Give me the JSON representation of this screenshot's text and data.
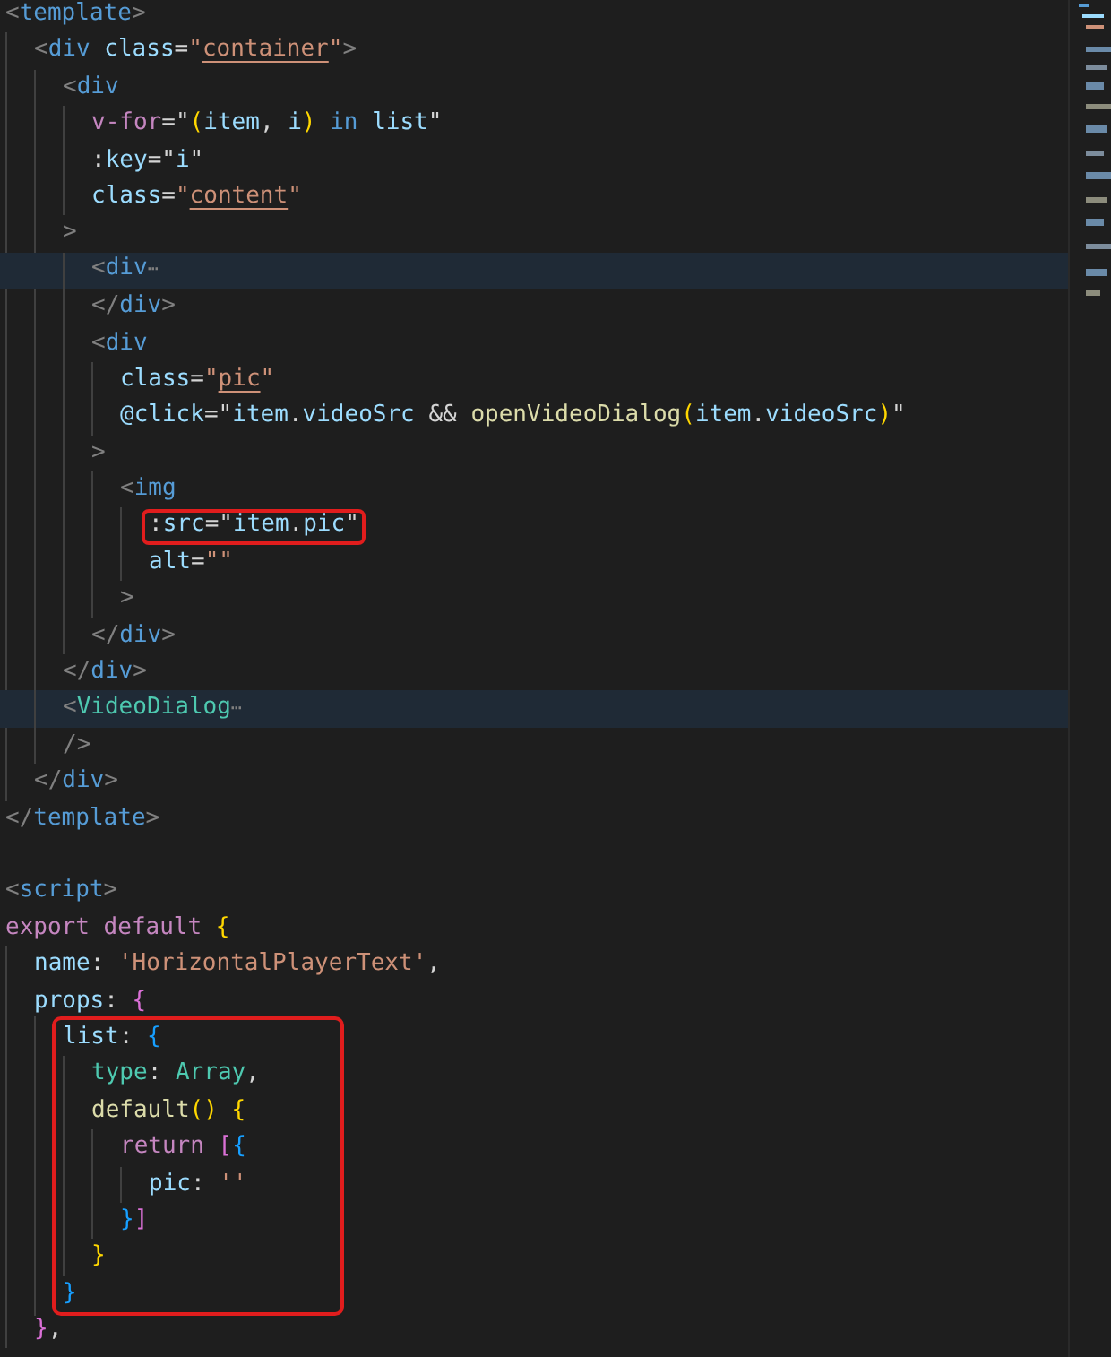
{
  "editor": {
    "lines": [
      {
        "tokens": [
          {
            "kind": "punct",
            "text": "<"
          },
          {
            "kind": "tag",
            "text": "template"
          },
          {
            "kind": "punct",
            "text": ">"
          }
        ],
        "children": [
          {
            "tokens": [
              {
                "kind": "punct",
                "text": "<"
              },
              {
                "kind": "tag",
                "text": "div"
              },
              {
                "kind": "attr",
                "text": " class"
              },
              {
                "kind": "text",
                "text": "="
              },
              {
                "kind": "string",
                "text": "\""
              },
              {
                "kind": "link",
                "text": "container"
              },
              {
                "kind": "string",
                "text": "\""
              },
              {
                "kind": "punct",
                "text": ">"
              }
            ],
            "children": [
              {
                "tokens": [
                  {
                    "kind": "punct",
                    "text": "<"
                  },
                  {
                    "kind": "tag",
                    "text": "div"
                  }
                ],
                "children": [
                  {
                    "tokens": [
                      {
                        "kind": "keyword",
                        "text": "v-for"
                      },
                      {
                        "kind": "text",
                        "text": "="
                      },
                      {
                        "kind": "text",
                        "text": "\""
                      },
                      {
                        "kind": "bracket1",
                        "text": "("
                      },
                      {
                        "kind": "variable",
                        "text": "item"
                      },
                      {
                        "kind": "text",
                        "text": ", "
                      },
                      {
                        "kind": "variable",
                        "text": "i"
                      },
                      {
                        "kind": "bracket1",
                        "text": ")"
                      },
                      {
                        "kind": "tag",
                        "text": " in "
                      },
                      {
                        "kind": "variable",
                        "text": "list"
                      },
                      {
                        "kind": "text",
                        "text": "\""
                      }
                    ]
                  },
                  {
                    "tokens": [
                      {
                        "kind": "text",
                        "text": ":"
                      },
                      {
                        "kind": "attr",
                        "text": "key"
                      },
                      {
                        "kind": "text",
                        "text": "=\""
                      },
                      {
                        "kind": "variable",
                        "text": "i"
                      },
                      {
                        "kind": "text",
                        "text": "\""
                      }
                    ]
                  },
                  {
                    "tokens": [
                      {
                        "kind": "attr",
                        "text": "class"
                      },
                      {
                        "kind": "text",
                        "text": "="
                      },
                      {
                        "kind": "string",
                        "text": "\""
                      },
                      {
                        "kind": "link",
                        "text": "content"
                      },
                      {
                        "kind": "string",
                        "text": "\""
                      }
                    ]
                  }
                ]
              },
              {
                "tokens": [
                  {
                    "kind": "punct",
                    "text": ">"
                  }
                ],
                "children": [
                  {
                    "highlighted": true,
                    "tokens": [
                      {
                        "kind": "punct",
                        "text": "<"
                      },
                      {
                        "kind": "tag",
                        "text": "div"
                      },
                      {
                        "kind": "fold",
                        "text": "⋯"
                      }
                    ]
                  },
                  {
                    "tokens": [
                      {
                        "kind": "punct",
                        "text": "</"
                      },
                      {
                        "kind": "tag",
                        "text": "div"
                      },
                      {
                        "kind": "punct",
                        "text": ">"
                      }
                    ]
                  },
                  {
                    "tokens": [
                      {
                        "kind": "punct",
                        "text": "<"
                      },
                      {
                        "kind": "tag",
                        "text": "div"
                      }
                    ],
                    "children": [
                      {
                        "tokens": [
                          {
                            "kind": "attr",
                            "text": "class"
                          },
                          {
                            "kind": "text",
                            "text": "="
                          },
                          {
                            "kind": "string",
                            "text": "\""
                          },
                          {
                            "kind": "link",
                            "text": "pic"
                          },
                          {
                            "kind": "string",
                            "text": "\""
                          }
                        ]
                      },
                      {
                        "tokens": [
                          {
                            "kind": "attr",
                            "text": "@click"
                          },
                          {
                            "kind": "text",
                            "text": "=\""
                          },
                          {
                            "kind": "variable",
                            "text": "item"
                          },
                          {
                            "kind": "text",
                            "text": "."
                          },
                          {
                            "kind": "variable",
                            "text": "videoSrc"
                          },
                          {
                            "kind": "text",
                            "text": " && "
                          },
                          {
                            "kind": "function",
                            "text": "openVideoDialog"
                          },
                          {
                            "kind": "bracket1",
                            "text": "("
                          },
                          {
                            "kind": "variable",
                            "text": "item"
                          },
                          {
                            "kind": "text",
                            "text": "."
                          },
                          {
                            "kind": "variable",
                            "text": "videoSrc"
                          },
                          {
                            "kind": "bracket1",
                            "text": ")"
                          },
                          {
                            "kind": "text",
                            "text": "\""
                          }
                        ]
                      }
                    ]
                  },
                  {
                    "tokens": [
                      {
                        "kind": "punct",
                        "text": ">"
                      }
                    ],
                    "children": [
                      {
                        "tokens": [
                          {
                            "kind": "punct",
                            "text": "<"
                          },
                          {
                            "kind": "tag",
                            "text": "img"
                          }
                        ],
                        "children": [
                          {
                            "boxed": true,
                            "tokens": [
                              {
                                "kind": "text",
                                "text": ":"
                              },
                              {
                                "kind": "attr",
                                "text": "src"
                              },
                              {
                                "kind": "text",
                                "text": "=\""
                              },
                              {
                                "kind": "variable",
                                "text": "item"
                              },
                              {
                                "kind": "text",
                                "text": "."
                              },
                              {
                                "kind": "variable",
                                "text": "pic"
                              },
                              {
                                "kind": "text",
                                "text": "\""
                              }
                            ]
                          },
                          {
                            "tokens": [
                              {
                                "kind": "attr",
                                "text": "alt"
                              },
                              {
                                "kind": "text",
                                "text": "="
                              },
                              {
                                "kind": "string",
                                "text": "\"\""
                              }
                            ]
                          }
                        ]
                      },
                      {
                        "tokens": [
                          {
                            "kind": "punct",
                            "text": ">"
                          }
                        ]
                      }
                    ]
                  },
                  {
                    "tokens": [
                      {
                        "kind": "punct",
                        "text": "</"
                      },
                      {
                        "kind": "tag",
                        "text": "div"
                      },
                      {
                        "kind": "punct",
                        "text": ">"
                      }
                    ]
                  }
                ]
              },
              {
                "tokens": [
                  {
                    "kind": "punct",
                    "text": "</"
                  },
                  {
                    "kind": "tag",
                    "text": "div"
                  },
                  {
                    "kind": "punct",
                    "text": ">"
                  }
                ]
              },
              {
                "highlighted": true,
                "tokens": [
                  {
                    "kind": "punct",
                    "text": "<"
                  },
                  {
                    "kind": "type",
                    "text": "VideoDialog"
                  },
                  {
                    "kind": "fold",
                    "text": "⋯"
                  }
                ]
              },
              {
                "tokens": [
                  {
                    "kind": "punct",
                    "text": "/>"
                  }
                ]
              }
            ]
          },
          {
            "tokens": [
              {
                "kind": "punct",
                "text": "</"
              },
              {
                "kind": "tag",
                "text": "div"
              },
              {
                "kind": "punct",
                "text": ">"
              }
            ]
          }
        ]
      },
      {
        "tokens": [
          {
            "kind": "punct",
            "text": "</"
          },
          {
            "kind": "tag",
            "text": "template"
          },
          {
            "kind": "punct",
            "text": ">"
          }
        ]
      },
      {
        "blank_before": true,
        "tokens": [
          {
            "kind": "punct",
            "text": "<"
          },
          {
            "kind": "tag",
            "text": "script"
          },
          {
            "kind": "punct",
            "text": ">"
          }
        ]
      },
      {
        "tokens": [
          {
            "kind": "keyword",
            "text": "export default "
          },
          {
            "kind": "bracket1",
            "text": "{"
          }
        ],
        "children": [
          {
            "tokens": [
              {
                "kind": "variable",
                "text": "name"
              },
              {
                "kind": "text",
                "text": ": "
              },
              {
                "kind": "string",
                "text": "'HorizontalPlayerText'"
              },
              {
                "kind": "text",
                "text": ","
              }
            ]
          },
          {
            "tokens": [
              {
                "kind": "variable",
                "text": "props"
              },
              {
                "kind": "text",
                "text": ": "
              },
              {
                "kind": "bracket2",
                "text": "{"
              }
            ],
            "children": [
              {
                "boxed": true,
                "tokens": [
                  {
                    "kind": "variable",
                    "text": "list"
                  },
                  {
                    "kind": "text",
                    "text": ": "
                  },
                  {
                    "kind": "bracket3",
                    "text": "{"
                  }
                ],
                "closing": [
                  {
                    "kind": "bracket3",
                    "text": "}"
                  }
                ],
                "children": [
                  {
                    "tokens": [
                      {
                        "kind": "type",
                        "text": "type"
                      },
                      {
                        "kind": "text",
                        "text": ": "
                      },
                      {
                        "kind": "type",
                        "text": "Array"
                      },
                      {
                        "kind": "text",
                        "text": ","
                      }
                    ]
                  },
                  {
                    "tokens": [
                      {
                        "kind": "function",
                        "text": "default"
                      },
                      {
                        "kind": "bracket1",
                        "text": "() {"
                      }
                    ],
                    "closing": [
                      {
                        "kind": "bracket1",
                        "text": "}"
                      }
                    ],
                    "children": [
                      {
                        "tokens": [
                          {
                            "kind": "keyword",
                            "text": "return "
                          },
                          {
                            "kind": "bracket2",
                            "text": "["
                          },
                          {
                            "kind": "bracket3",
                            "text": "{"
                          }
                        ],
                        "closing": [
                          {
                            "kind": "bracket3",
                            "text": "}"
                          },
                          {
                            "kind": "bracket2",
                            "text": "]"
                          }
                        ],
                        "children": [
                          {
                            "tokens": [
                              {
                                "kind": "variable",
                                "text": "pic"
                              },
                              {
                                "kind": "text",
                                "text": ": "
                              },
                              {
                                "kind": "string",
                                "text": "''"
                              }
                            ]
                          }
                        ]
                      }
                    ]
                  }
                ]
              }
            ]
          },
          {
            "tokens": [
              {
                "kind": "bracket2",
                "text": "}"
              },
              {
                "kind": "text",
                "text": ","
              }
            ]
          }
        ]
      }
    ]
  }
}
